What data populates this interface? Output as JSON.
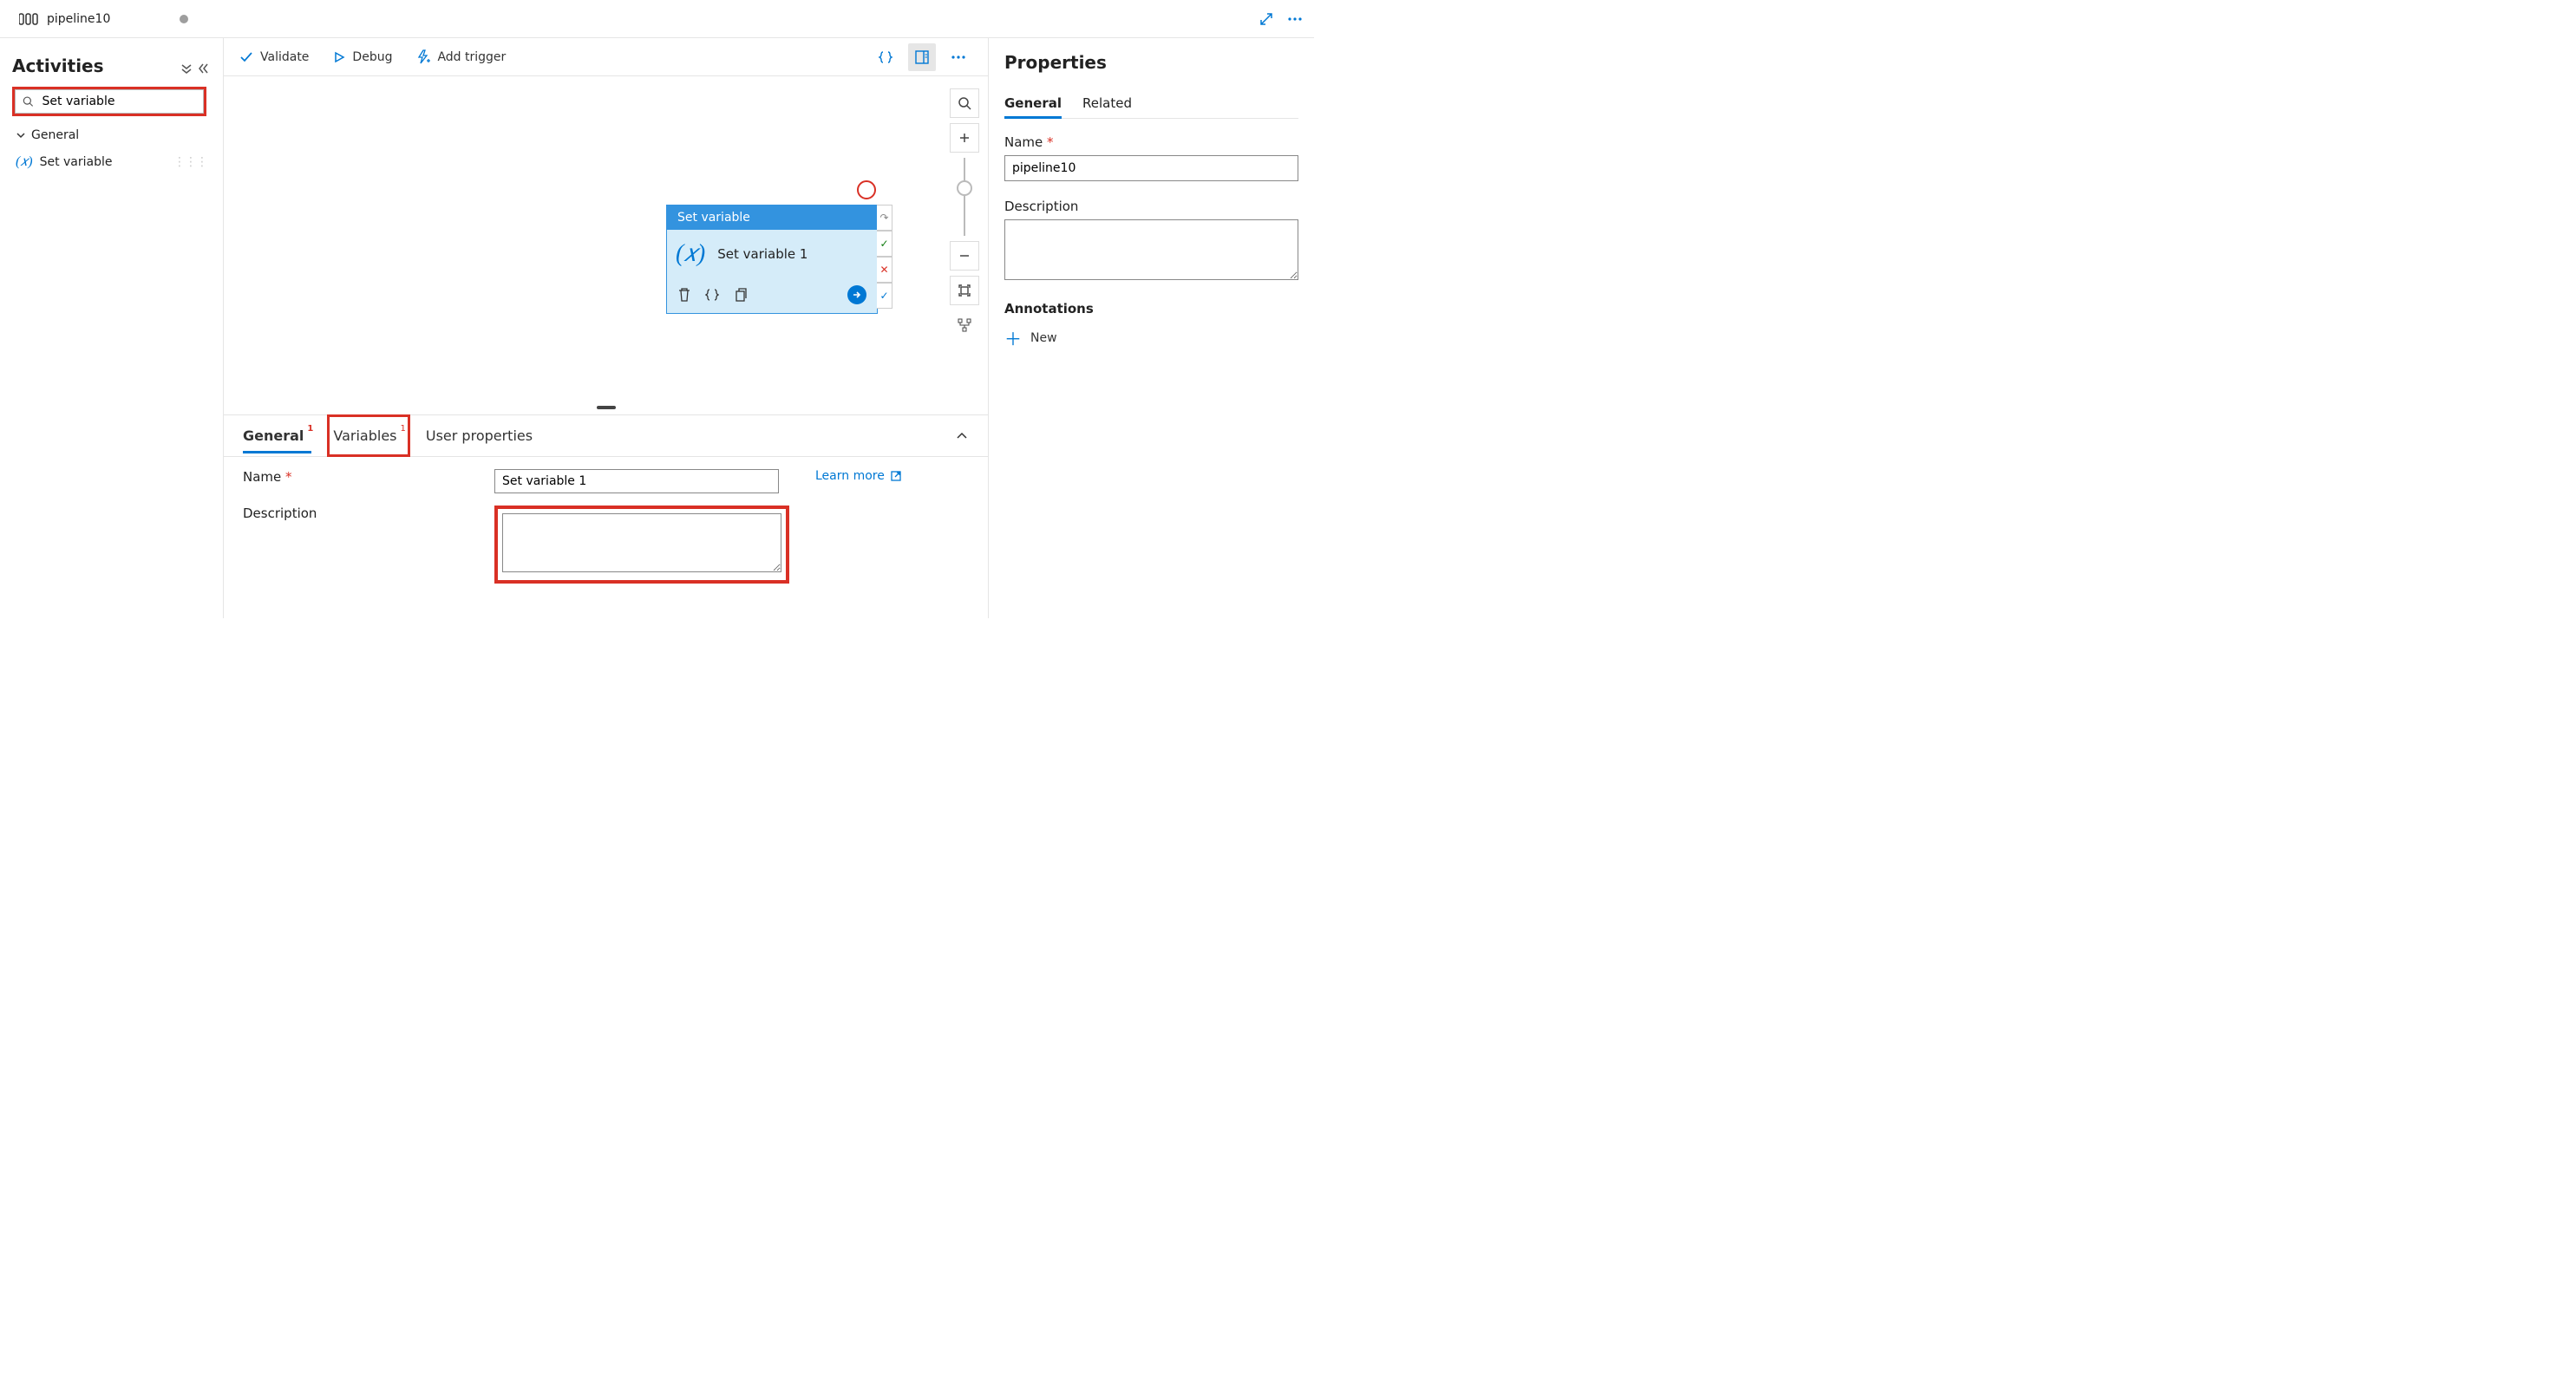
{
  "titlebar": {
    "tab_label": "pipeline10"
  },
  "sidebar": {
    "title": "Activities",
    "search_value": "Set variable",
    "group_label": "General",
    "items": [
      {
        "label": "Set variable"
      }
    ]
  },
  "toolbar": {
    "validate": "Validate",
    "debug": "Debug",
    "add_trigger": "Add trigger"
  },
  "node": {
    "title": "Set variable",
    "name": "Set variable 1"
  },
  "bottom": {
    "tabs": {
      "general": "General",
      "variables": "Variables",
      "user_properties": "User properties"
    },
    "badge": "1",
    "name_label": "Name",
    "name_value": "Set variable 1",
    "desc_label": "Description",
    "desc_value": "",
    "learn_more": "Learn more"
  },
  "props": {
    "title": "Properties",
    "tabs": {
      "general": "General",
      "related": "Related"
    },
    "name_label": "Name",
    "name_value": "pipeline10",
    "desc_label": "Description",
    "desc_value": "",
    "annotations_label": "Annotations",
    "new_label": "New"
  }
}
